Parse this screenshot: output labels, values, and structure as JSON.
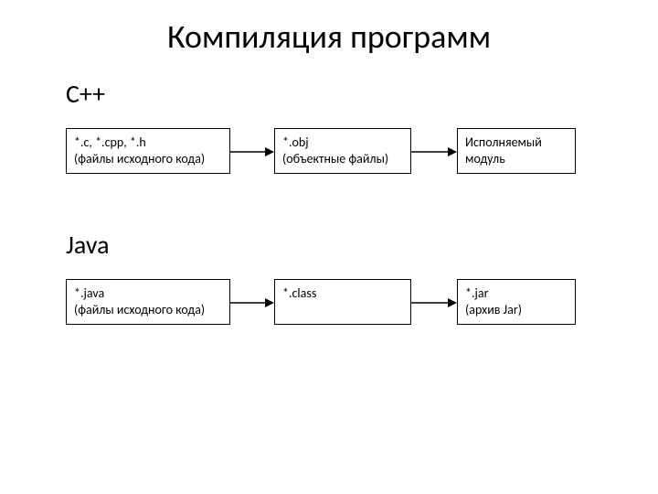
{
  "title": "Компиляция программ",
  "sections": {
    "cpp": {
      "label": "C++",
      "box1": {
        "line1": "*.c, *.cpp, *.h",
        "line2": "(файлы исходного кода)"
      },
      "box2": {
        "line1": "*.obj",
        "line2": "(объектные файлы)"
      },
      "box3": {
        "line1": "Исполняемый",
        "line2": "модуль"
      }
    },
    "java": {
      "label": "Java",
      "box1": {
        "line1": "*.java",
        "line2": "(файлы исходного кода)"
      },
      "box2": {
        "line1": "*.class",
        "line2": ""
      },
      "box3": {
        "line1": "*.jar",
        "line2": "(архив Jar)"
      }
    }
  }
}
